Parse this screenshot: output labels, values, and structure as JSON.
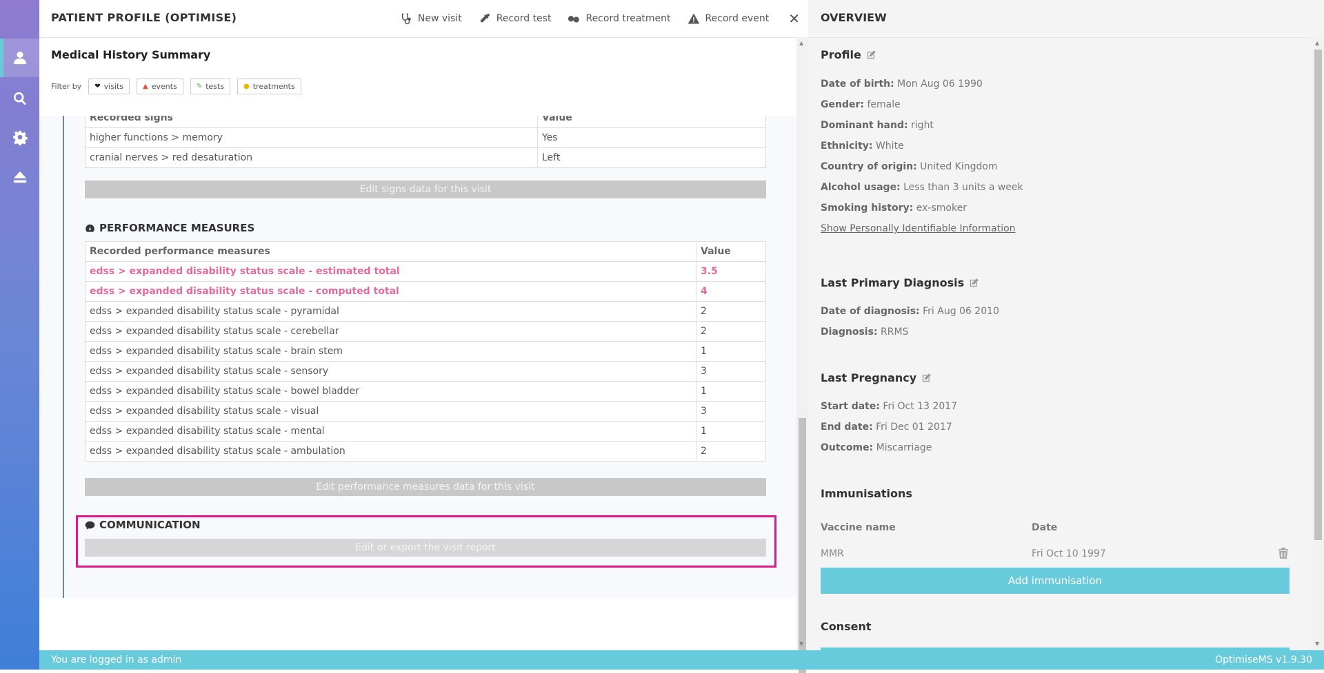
{
  "main": {
    "title": "PATIENT PROFILE (OPTIMISE)",
    "actions": {
      "new_visit": "New visit",
      "record_test": "Record test",
      "record_treatment": "Record treatment",
      "record_event": "Record event",
      "close": "✕"
    },
    "summary_title": "Medical History Summary",
    "filter": {
      "label": "Filter by",
      "chips": [
        "visits",
        "events",
        "tests",
        "treatments"
      ]
    },
    "signs": {
      "header_partial": [
        "Recorded signs",
        "Value"
      ],
      "rows": [
        [
          "higher functions > memory",
          "Yes"
        ],
        [
          "cranial nerves > red desaturation",
          "Left"
        ]
      ],
      "edit_button": "Edit signs data for this visit"
    },
    "performance": {
      "title": "PERFORMANCE MEASURES",
      "headers": [
        "Recorded performance measures",
        "Value"
      ],
      "highlight_rows": [
        [
          "edss > expanded disability status scale - estimated total",
          "3.5"
        ],
        [
          "edss > expanded disability status scale - computed total",
          "4"
        ]
      ],
      "rows": [
        [
          "edss > expanded disability status scale - pyramidal",
          "2"
        ],
        [
          "edss > expanded disability status scale - cerebellar",
          "2"
        ],
        [
          "edss > expanded disability status scale - brain stem",
          "1"
        ],
        [
          "edss > expanded disability status scale - sensory",
          "3"
        ],
        [
          "edss > expanded disability status scale - bowel bladder",
          "1"
        ],
        [
          "edss > expanded disability status scale - visual",
          "3"
        ],
        [
          "edss > expanded disability status scale - mental",
          "1"
        ],
        [
          "edss > expanded disability status scale - ambulation",
          "2"
        ]
      ],
      "edit_button": "Edit performance measures data for this visit"
    },
    "communication": {
      "title": "COMMUNICATION",
      "button": "Edit or export the visit report"
    }
  },
  "overview": {
    "title": "OVERVIEW",
    "profile": {
      "title": "Profile",
      "fields": [
        {
          "label": "Date of birth:",
          "value": "Mon Aug 06 1990"
        },
        {
          "label": "Gender:",
          "value": "female"
        },
        {
          "label": "Dominant hand:",
          "value": "right"
        },
        {
          "label": "Ethnicity:",
          "value": "White"
        },
        {
          "label": "Country of origin:",
          "value": "United Kingdom"
        },
        {
          "label": "Alcohol usage:",
          "value": "Less than 3 units a week"
        },
        {
          "label": "Smoking history:",
          "value": "ex-smoker"
        }
      ],
      "pii_link": "Show Personally Identifiable Information"
    },
    "diagnosis": {
      "title": "Last Primary Diagnosis",
      "fields": [
        {
          "label": "Date of diagnosis:",
          "value": "Fri Aug 06 2010"
        },
        {
          "label": "Diagnosis:",
          "value": "RRMS"
        }
      ]
    },
    "pregnancy": {
      "title": "Last Pregnancy",
      "fields": [
        {
          "label": "Start date:",
          "value": "Fri Oct 13 2017"
        },
        {
          "label": "End date:",
          "value": "Fri Dec 01 2017"
        },
        {
          "label": "Outcome:",
          "value": "Miscarriage"
        }
      ]
    },
    "immunisations": {
      "title": "Immunisations",
      "headers": [
        "Vaccine name",
        "Date"
      ],
      "rows": [
        [
          "MMR",
          "Fri Oct 10 1997"
        ]
      ],
      "add_button": "Add immunisation"
    },
    "consent": {
      "title": "Consent"
    }
  },
  "footer": {
    "logged_in": "You are logged in as admin",
    "version": "OptimiseMS v1.9.30"
  },
  "colors": {
    "accent": "#67cbdb",
    "highlight": "#e0198a",
    "pink_text": "#e56a9c"
  }
}
